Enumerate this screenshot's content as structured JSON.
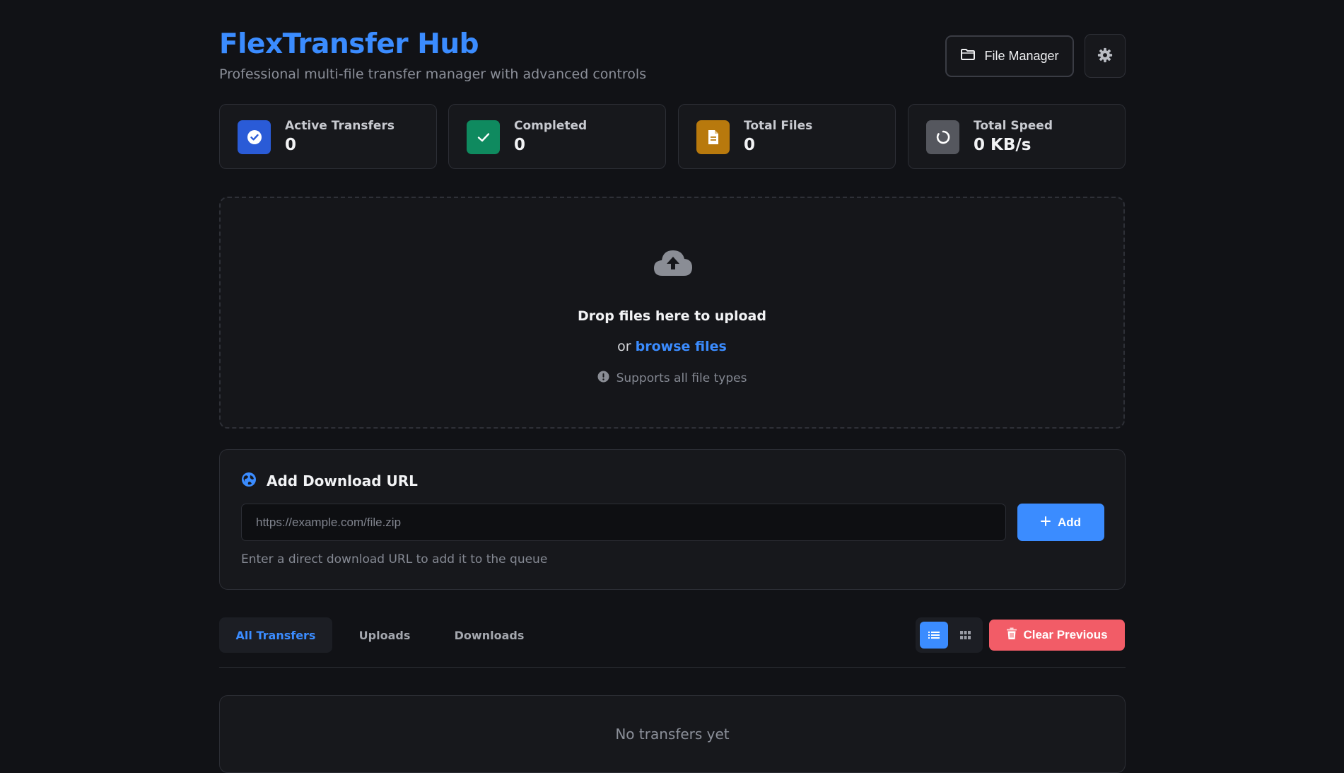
{
  "header": {
    "title": "FlexTransfer Hub",
    "subtitle": "Professional multi-file transfer manager with advanced controls",
    "file_manager_label": "File Manager"
  },
  "stats": [
    {
      "label": "Active Transfers",
      "value": "0",
      "icon": "check-circle-icon",
      "color": "#2a5bd7"
    },
    {
      "label": "Completed",
      "value": "0",
      "icon": "check-icon",
      "color": "#0f8a5f"
    },
    {
      "label": "Total Files",
      "value": "0",
      "icon": "document-icon",
      "color": "#b8790d"
    },
    {
      "label": "Total Speed",
      "value": "0 KB/s",
      "icon": "spinner-icon",
      "color": "#55575e"
    }
  ],
  "dropzone": {
    "title": "Drop files here to upload",
    "or_text": "or",
    "browse_link": "browse files",
    "note": "Supports all file types"
  },
  "url_panel": {
    "heading": "Add Download URL",
    "placeholder": "https://example.com/file.zip",
    "value": "",
    "add_label": "Add",
    "help": "Enter a direct download URL to add it to the queue"
  },
  "tabs": [
    {
      "label": "All Transfers",
      "active": true
    },
    {
      "label": "Uploads",
      "active": false
    },
    {
      "label": "Downloads",
      "active": false
    }
  ],
  "toolbar": {
    "view_mode": "list",
    "clear_label": "Clear Previous"
  },
  "transfers": {
    "empty_text": "No transfers yet"
  },
  "colors": {
    "accent": "#3b8cff",
    "danger": "#f25c67",
    "background": "#111216",
    "panel": "#17181c"
  }
}
